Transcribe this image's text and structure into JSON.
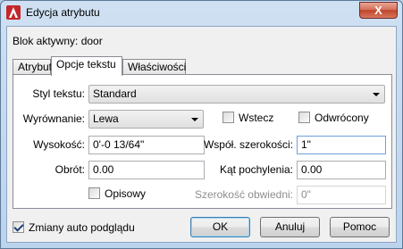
{
  "window": {
    "title": "Edycja atrybutu",
    "close_label": "X"
  },
  "header": {
    "block_label": "Blok aktywny: door"
  },
  "tabs": [
    {
      "label": "Atrybut",
      "active": false
    },
    {
      "label": "Opcje tekstu",
      "active": true
    },
    {
      "label": "Właściwości",
      "active": false
    }
  ],
  "text_options": {
    "style_label": "Styl tekstu:",
    "style_value": "Standard",
    "justify_label": "Wyrównanie:",
    "justify_value": "Lewa",
    "backwards_label": "Wstecz",
    "backwards_checked": false,
    "upside_down_label": "Odwrócony",
    "upside_down_checked": false,
    "height_label": "Wysokość:",
    "height_value": "0'-0 13/64\"",
    "width_factor_label": "Współ. szerokości:",
    "width_factor_value": "1\"",
    "rotation_label": "Obrót:",
    "rotation_value": "0.00",
    "oblique_label": "Kąt pochylenia:",
    "oblique_value": "0.00",
    "annotative_label": "Opisowy",
    "annotative_checked": false,
    "boundary_width_label": "Szerokość obwiedni:",
    "boundary_width_value": "0\""
  },
  "footer": {
    "auto_preview_label": "Zmiany auto podglądu",
    "auto_preview_checked": true,
    "ok_label": "OK",
    "cancel_label": "Anuluj",
    "help_label": "Pomoc"
  }
}
